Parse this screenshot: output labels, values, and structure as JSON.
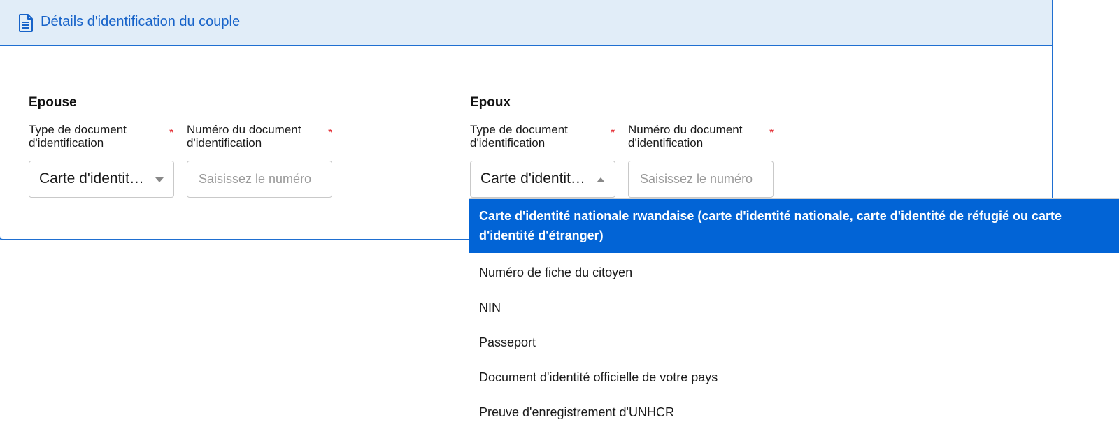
{
  "card": {
    "title": "Détails d'identification du couple",
    "icon": "document-icon"
  },
  "wife": {
    "section_title": "Epouse",
    "doc_type_label": "Type de document d'identification",
    "doc_number_label": "Numéro du document d'identification",
    "required_mark": "*",
    "doc_type_value": "Carte d'identité nationale rwandaise",
    "doc_number_placeholder": "Saisissez le numéro"
  },
  "husband": {
    "section_title": "Epoux",
    "doc_type_label": "Type de document d'identification",
    "doc_number_label": "Numéro du document d'identification",
    "required_mark": "*",
    "doc_type_value": "Carte d'identité nationale rwandaise",
    "doc_number_placeholder": "Saisissez le numéro"
  },
  "dropdown": {
    "options": [
      "Carte d'identité nationale rwandaise (carte d'identité nationale, carte d'identité de réfugié ou carte d'identité d'étranger)",
      "Numéro de fiche du citoyen",
      "NIN",
      "Passeport",
      "Document d'identité officielle de votre pays",
      "Preuve d'enregistrement d'UNHCR"
    ],
    "selected_index": 0
  },
  "colors": {
    "accent": "#1f6fd1",
    "header_bg": "#e1edf8",
    "selected_option_bg": "#0264d6",
    "required": "#e3262d"
  }
}
